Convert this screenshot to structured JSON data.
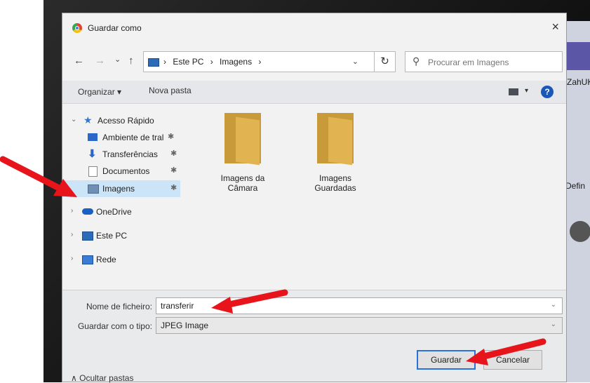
{
  "dialog": {
    "title": "Guardar como",
    "close_glyph": "×"
  },
  "nav": {
    "back": "←",
    "forward": "→",
    "recent": "⌄",
    "up": "↑",
    "breadcrumb": [
      "Este PC",
      "›",
      "Imagens",
      "›"
    ],
    "breadcrumb_sep_first": "›",
    "address_dropdown": "⌄",
    "refresh": "↻",
    "search_placeholder": "Procurar em Imagens"
  },
  "toolbar": {
    "organize": "Organizar ▾",
    "new_folder": "Nova pasta",
    "view_dropdown": "▾",
    "help": "?"
  },
  "sidebar": {
    "items": [
      {
        "label": "Acesso Rápido",
        "chev": "⌄",
        "pinned": false
      },
      {
        "label": "Ambiente de tral",
        "pinned": true
      },
      {
        "label": "Transferências",
        "pinned": true
      },
      {
        "label": "Documentos",
        "pinned": true
      },
      {
        "label": "Imagens",
        "pinned": true
      },
      {
        "label": "OneDrive",
        "chev": "›"
      },
      {
        "label": "Este PC",
        "chev": "›"
      },
      {
        "label": "Rede",
        "chev": "›"
      }
    ],
    "pin_glyph": "✱"
  },
  "folders": [
    {
      "line1": "Imagens da",
      "line2": "Câmara"
    },
    {
      "line1": "Imagens",
      "line2": "Guardadas"
    }
  ],
  "form": {
    "filename_label": "Nome de ficheiro:",
    "filename_value": "transferir",
    "type_label": "Guardar com o tipo:",
    "type_value": "JPEG Image",
    "dropdown_glyph": "⌄"
  },
  "footer": {
    "hide_folders": "∧  Ocultar pastas",
    "save": "Guardar",
    "cancel": "Cancelar"
  },
  "background_app": {
    "text1": "ZahUK",
    "text2": "Defin"
  },
  "colors": {
    "annotation_arrow": "#e8141b",
    "selection": "#cce4f7",
    "primary_border": "#2a72d8"
  }
}
